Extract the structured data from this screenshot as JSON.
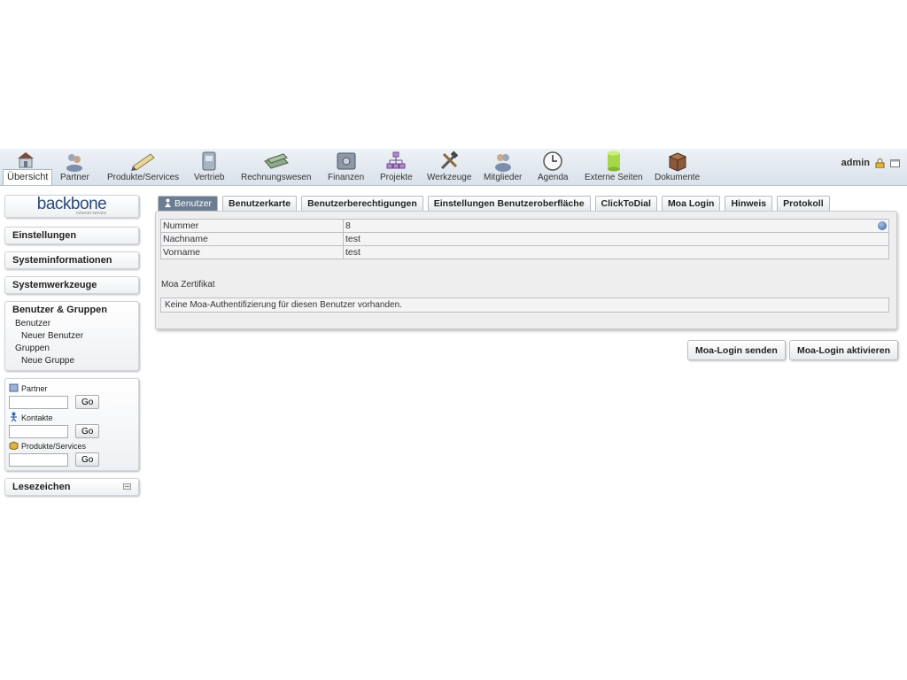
{
  "nav": {
    "items": [
      {
        "label": "Übersicht",
        "icon": "house-icon"
      },
      {
        "label": "Partner",
        "icon": "people-icon"
      },
      {
        "label": "Produkte/Services",
        "icon": "pencil-icon"
      },
      {
        "label": "Vertrieb",
        "icon": "vertrieb-icon"
      },
      {
        "label": "Rechnungswesen",
        "icon": "money-icon"
      },
      {
        "label": "Finanzen",
        "icon": "safe-icon"
      },
      {
        "label": "Projekte",
        "icon": "hierarchy-icon"
      },
      {
        "label": "Werkzeuge",
        "icon": "tools-icon"
      },
      {
        "label": "Mitglieder",
        "icon": "members-icon"
      },
      {
        "label": "Agenda",
        "icon": "clock-icon"
      },
      {
        "label": "Externe Seiten",
        "icon": "cylinder-icon"
      },
      {
        "label": "Dokumente",
        "icon": "box-icon"
      }
    ],
    "active": "Übersicht",
    "user": "admin"
  },
  "sidebar": {
    "logo": {
      "name": "backbone",
      "tagline": "internet service"
    },
    "sections": [
      {
        "label": "Einstellungen"
      },
      {
        "label": "Systeminformationen"
      },
      {
        "label": "Systemwerkzeuge"
      }
    ],
    "group": {
      "title": "Benutzer & Gruppen",
      "items": [
        {
          "label": "Benutzer",
          "level": 1
        },
        {
          "label": "Neuer Benutzer",
          "level": 2
        },
        {
          "label": "Gruppen",
          "level": 1
        },
        {
          "label": "Neue Gruppe",
          "level": 2
        }
      ]
    },
    "search": [
      {
        "label": "Partner",
        "value": "",
        "button": "Go"
      },
      {
        "label": "Kontakte",
        "value": "",
        "button": "Go"
      },
      {
        "label": "Produkte/Services",
        "value": "",
        "button": "Go"
      }
    ],
    "bookmarks": {
      "label": "Lesezeichen"
    }
  },
  "tabs": [
    {
      "label": "Benutzer",
      "active": true
    },
    {
      "label": "Benutzerkarte"
    },
    {
      "label": "Benutzerberechtigungen"
    },
    {
      "label": "Einstellungen Benutzeroberfläche"
    },
    {
      "label": "ClickToDial"
    },
    {
      "label": "Moa Login"
    },
    {
      "label": "Hinweis"
    },
    {
      "label": "Protokoll"
    }
  ],
  "user_info": {
    "rows": [
      {
        "key": "Nummer",
        "value": "8"
      },
      {
        "key": "Nachname",
        "value": "test"
      },
      {
        "key": "Vorname",
        "value": "test"
      }
    ]
  },
  "moa": {
    "title": "Moa Zertifikat",
    "message": "Keine Moa-Authentifizierung für diesen Benutzer vorhanden."
  },
  "actions": {
    "send": "Moa-Login senden",
    "activate": "Moa-Login aktivieren"
  }
}
